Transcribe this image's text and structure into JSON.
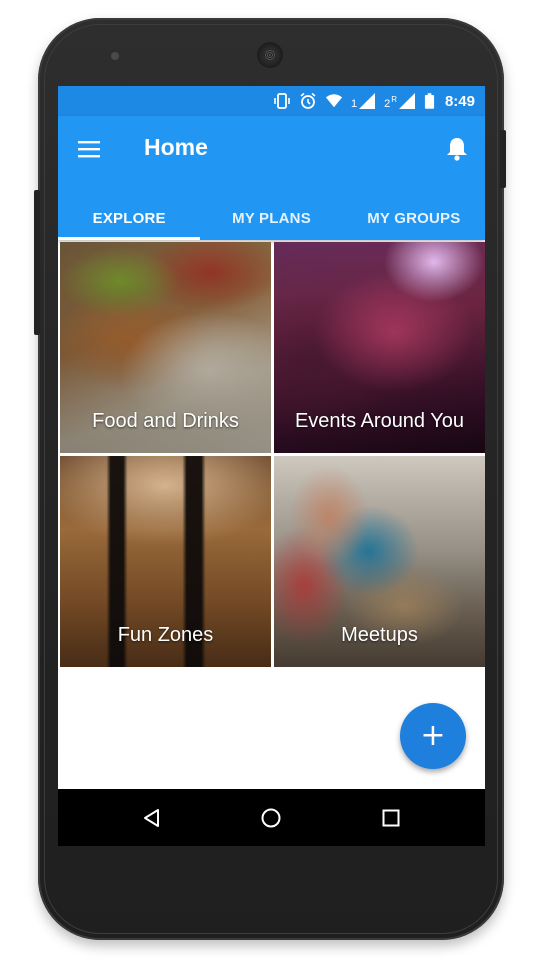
{
  "status_bar": {
    "time": "8:49",
    "icons": [
      "vibrate-icon",
      "alarm-icon",
      "wifi-icon",
      "signal-icon",
      "signal-roaming-icon",
      "battery-icon"
    ],
    "sim1_label": "1",
    "sim2_label": "2",
    "sim2_roaming": "R"
  },
  "app_bar": {
    "title": "Home",
    "menu_icon": "hamburger-menu-icon",
    "notification_icon": "bell-icon"
  },
  "tabs": [
    {
      "label": "EXPLORE",
      "active": true
    },
    {
      "label": "MY PLANS",
      "active": false
    },
    {
      "label": "MY GROUPS",
      "active": false
    }
  ],
  "categories": [
    {
      "label": "Food and Drinks"
    },
    {
      "label": "Events Around You"
    },
    {
      "label": "Fun Zones"
    },
    {
      "label": "Meetups"
    }
  ],
  "fab": {
    "icon": "+"
  },
  "nav_bar": {
    "icons": [
      "back-icon",
      "home-icon",
      "recents-icon"
    ]
  },
  "colors": {
    "primary": "#2196f3",
    "status_bar": "#1e88e5",
    "fab": "#1e7fdc"
  }
}
